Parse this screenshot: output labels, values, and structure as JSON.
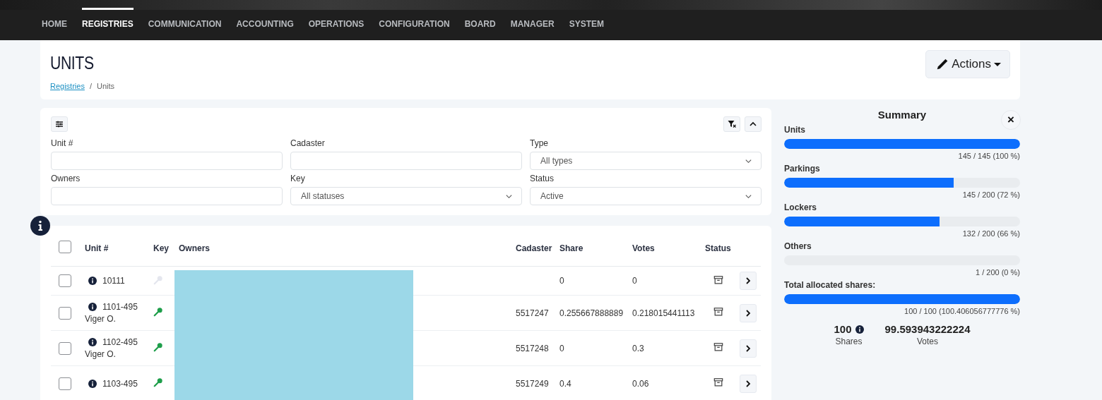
{
  "nav": {
    "items": [
      {
        "label": "HOME",
        "selected": false
      },
      {
        "label": "REGISTRIES",
        "selected": true
      },
      {
        "label": "COMMUNICATION",
        "selected": false
      },
      {
        "label": "ACCOUNTING",
        "selected": false
      },
      {
        "label": "OPERATIONS",
        "selected": false
      },
      {
        "label": "CONFIGURATION",
        "selected": false
      },
      {
        "label": "BOARD",
        "selected": false
      },
      {
        "label": "MANAGER",
        "selected": false
      },
      {
        "label": "SYSTEM",
        "selected": false
      }
    ]
  },
  "header": {
    "title": "UNITS",
    "breadcrumb": [
      {
        "label": "Registries",
        "kind": "link"
      },
      {
        "label": "/",
        "kind": "separator"
      },
      {
        "label": "Units",
        "kind": "current"
      }
    ],
    "actions_button": "Actions"
  },
  "filters": {
    "fields": [
      {
        "label": "Unit #",
        "kind": "text"
      },
      {
        "label": "Cadaster",
        "kind": "text"
      },
      {
        "label": "Type",
        "kind": "select",
        "value": "All types"
      },
      {
        "label": "Owners",
        "kind": "text"
      },
      {
        "label": "Key",
        "kind": "select",
        "value": "All statuses"
      },
      {
        "label": "Status",
        "kind": "select",
        "value": "Active"
      }
    ]
  },
  "table": {
    "select_all_checked": false,
    "columns": [
      "Unit #",
      "Key",
      "Owners",
      "Cadaster",
      "Share",
      "Votes",
      "Status"
    ],
    "rows": [
      {
        "unit": "10111",
        "key_assigned": false,
        "cadaster": "",
        "share": "0",
        "votes": "0",
        "checked": false
      },
      {
        "unit": "1101-495",
        "subtitle": "Viger O.",
        "key_assigned": true,
        "cadaster": "5517247",
        "share": "0.255667888889",
        "votes": "0.218015441113",
        "checked": false
      },
      {
        "unit": "1102-495",
        "subtitle": "Viger O.",
        "key_assigned": true,
        "cadaster": "5517248",
        "share": "0",
        "votes": "0.3",
        "checked": false
      },
      {
        "unit": "1103-495",
        "key_assigned": true,
        "cadaster": "5517249",
        "share": "0.4",
        "votes": "0.06",
        "checked": false
      }
    ]
  },
  "summary": {
    "title": "Summary",
    "close": "×",
    "meters": [
      {
        "label": "Units",
        "level": 1.0,
        "reading": "145 / 145 (100 %)"
      },
      {
        "label": "Parkings",
        "level": 0.72,
        "reading": "145 / 200 (72 %)"
      },
      {
        "label": "Lockers",
        "level": 0.66,
        "reading": "132 / 200 (66 %)"
      },
      {
        "label": "Others",
        "level": 0.0,
        "reading": "1 / 200 (0 %)"
      },
      {
        "label": "Total allocated shares:",
        "level": 1.0,
        "reading": "100 / 100 (100.406056777776 %)"
      }
    ],
    "stats": [
      {
        "value": "100",
        "label": "Shares",
        "info": true
      },
      {
        "value": "99.593943222224",
        "label": "Votes",
        "info": false
      }
    ]
  }
}
